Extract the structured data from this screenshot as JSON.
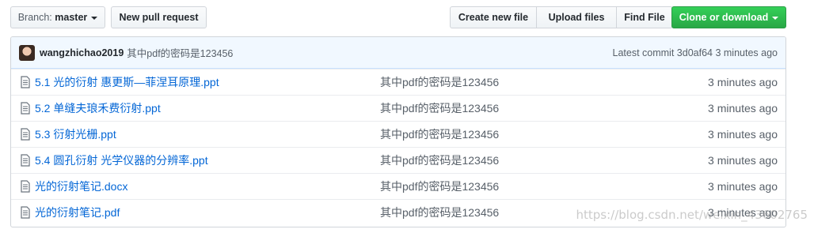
{
  "toolbar": {
    "branch_prefix": "Branch:",
    "branch_name": "master",
    "new_pr": "New pull request",
    "create_file": "Create new file",
    "upload_files": "Upload files",
    "find_file": "Find File",
    "clone": "Clone or download"
  },
  "commit": {
    "author": "wangzhichao2019",
    "message": "其中pdf的密码是123456",
    "latest_label": "Latest commit",
    "sha": "3d0af64",
    "age": "3 minutes ago"
  },
  "files": [
    {
      "name": "5.1 光的衍射 惠更斯—菲涅耳原理.ppt",
      "message": "其中pdf的密码是123456",
      "age": "3 minutes ago"
    },
    {
      "name": "5.2 单缝夫琅禾费衍射.ppt",
      "message": "其中pdf的密码是123456",
      "age": "3 minutes ago"
    },
    {
      "name": "5.3 衍射光栅.ppt",
      "message": "其中pdf的密码是123456",
      "age": "3 minutes ago"
    },
    {
      "name": "5.4 圆孔衍射 光学仪器的分辨率.ppt",
      "message": "其中pdf的密码是123456",
      "age": "3 minutes ago"
    },
    {
      "name": "光的衍射笔记.docx",
      "message": "其中pdf的密码是123456",
      "age": "3 minutes ago"
    },
    {
      "name": "光的衍射笔记.pdf",
      "message": "其中pdf的密码是123456",
      "age": "3 minutes ago"
    }
  ],
  "watermark": "https://blog.csdn.net/weixin_43602765",
  "colors": {
    "link": "#0366d6",
    "clone_green": "#28a745",
    "commit_bg": "#f1f8ff"
  }
}
